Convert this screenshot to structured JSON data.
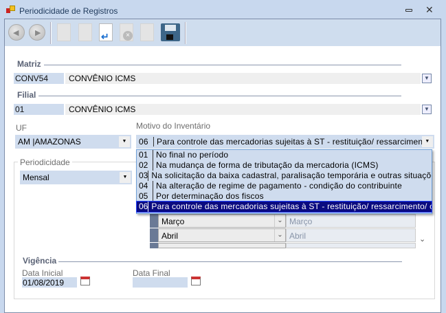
{
  "window": {
    "title": "Periodicidade de Registros",
    "icon": "app-form-icon"
  },
  "toolbar": {
    "buttons": [
      "back-icon",
      "forward-icon",
      "new-icon",
      "edit-icon",
      "undo-icon",
      "delete-icon",
      "redo-icon",
      "save-icon"
    ]
  },
  "matriz": {
    "label": "Matriz",
    "code": "CONV54",
    "desc": "CONVÊNIO ICMS"
  },
  "filial": {
    "label": "Filial",
    "code": "01",
    "desc": "CONVÊNIO ICMS"
  },
  "uf": {
    "label": "UF",
    "value": "AM |AMAZONAS"
  },
  "motivo": {
    "label": "Motivo do Inventário",
    "code": "06",
    "value": "Para controle das mercadorias sujeitas à ST - restituição/ ressarcimento/ com",
    "options": [
      {
        "code": "01",
        "text": "No final no período"
      },
      {
        "code": "02",
        "text": "Na mudança de forma de tributação da mercadoria (ICMS)"
      },
      {
        "code": "03",
        "text": "Na solicitação da baixa cadastral, paralisação temporária e outras situações"
      },
      {
        "code": "04",
        "text": "Na alteração de regime de pagamento - condição do contribuinte"
      },
      {
        "code": "05",
        "text": "Por determinação dos fiscos"
      },
      {
        "code": "06",
        "text": "Para controle das mercadorias sujeitas à ST - restituição/ ressarcimento/ complem"
      }
    ],
    "selected": "06"
  },
  "periodicidade": {
    "label": "Periodicidade",
    "value": "Mensal",
    "grid": [
      {
        "c1": "Março",
        "c2": "Março"
      },
      {
        "c1": "Abril",
        "c2": "Abril"
      }
    ]
  },
  "vigencia": {
    "label": "Vigência",
    "inicial_label": "Data Inicial",
    "inicial": "01/08/2019",
    "final_label": "Data Final",
    "final": ""
  }
}
